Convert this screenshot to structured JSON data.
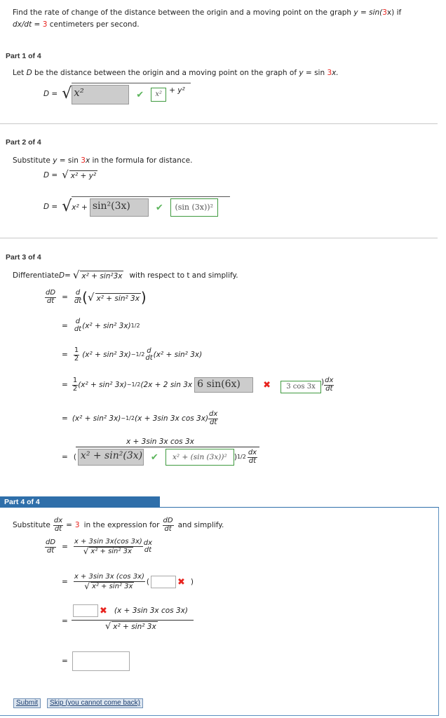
{
  "problem": {
    "line1_prefix": "Find the rate of change of the distance between the origin and a moving point on the graph ",
    "line1_eq": "y = sin(",
    "line1_coef": "3",
    "line1_tail": "x) if",
    "line2_var": "dx/dt",
    "line2_eq": " = ",
    "line2_value": "3",
    "line2_tail": " centimeters per second."
  },
  "part1": {
    "label": "Part 1 of 4",
    "intro_prefix": "Let ",
    "intro_D": "D",
    "intro_mid": " be the distance between the origin and a moving point on the graph of ",
    "intro_y": "y",
    "intro_eq": " = sin ",
    "intro_coef": "3",
    "intro_x": "x.",
    "lhs": "D =",
    "answer_entered": "x²",
    "answer_status": "correct",
    "correct_answer": "x²",
    "tail": "+ y²"
  },
  "part2": {
    "label": "Part 2 of 4",
    "intro_prefix": "Substitute ",
    "intro_y": "y",
    "intro_eq": " = sin ",
    "intro_coef": "3",
    "intro_x": "x",
    "intro_tail": " in the formula for distance.",
    "formula_lhs": "D =",
    "formula_radicand": "x² + y²",
    "lhs": "D =",
    "radicand_prefix": "x² +",
    "answer_entered": "sin²(3x)",
    "answer_status": "correct",
    "correct_answer": "(sin (3x))²"
  },
  "part3": {
    "label": "Part 3 of 4",
    "intro_prefix": "Differentiate ",
    "intro_D": "D",
    "intro_eq": " = ",
    "intro_radicand": "x² + sin²3x",
    "intro_tail": "with respect to t and simplify.",
    "step1": {
      "lhs_num": "dD",
      "lhs_den": "dt",
      "eq": "=",
      "d_num": "d",
      "d_den": "dt",
      "radicand": "x² + sin² 3x"
    },
    "step2": {
      "eq": "=",
      "d_num": "d",
      "d_den": "dt",
      "expr": "(x² + sin² 3x)",
      "exp": "1/2"
    },
    "step3": {
      "eq": "=",
      "half_num": "1",
      "half_den": "2",
      "expr": "(x² + sin² 3x)",
      "exp": "−1/2",
      "d_num": "d",
      "d_den": "dt",
      "tail": "(x² + sin² 3x)"
    },
    "step4": {
      "eq": "=",
      "half_num": "1",
      "half_den": "2",
      "expr": "(x² + sin² 3x)",
      "exp": "−1/2",
      "inner": "(2x + 2 sin 3x",
      "answer_entered": "6 sin(6x)",
      "answer_status": "incorrect",
      "correct_answer": "3 cos 3x",
      "tail_num": "dx",
      "tail_den": "dt"
    },
    "step5": {
      "eq": "=",
      "expr": "(x² + sin² 3x)",
      "exp": "−1/2",
      "inner": "(x + 3sin 3x cos 3x)",
      "tail_num": "dx",
      "tail_den": "dt"
    },
    "step6": {
      "eq": "=",
      "numerator": "x + 3sin 3x cos 3x",
      "answer_entered": "x² + sin²(3x)",
      "answer_status": "correct",
      "correct_answer": "x² + (sin (3x))²",
      "exp": "1/2",
      "tail_num": "dx",
      "tail_den": "dt"
    }
  },
  "part4": {
    "label": "Part 4 of 4",
    "intro_prefix": "Substitute",
    "intro_frac_num": "dx",
    "intro_frac_den": "dt",
    "intro_eq": "=",
    "intro_value": "3",
    "intro_mid": "in the expression for",
    "intro_frac2_num": "dD",
    "intro_frac2_den": "dt",
    "intro_tail": "and simplify.",
    "step1": {
      "lhs_num": "dD",
      "lhs_den": "dt",
      "eq": "=",
      "num": "x + 3sin 3x(cos 3x)",
      "den": "x² + sin² 3x",
      "tail_num": "dx",
      "tail_den": "dt"
    },
    "step2": {
      "eq": "=",
      "num": "x + 3sin 3x (cos 3x)",
      "den": "x² + sin² 3x",
      "input_value": "",
      "input_status": "incorrect"
    },
    "step3": {
      "eq": "=",
      "input_value": "",
      "input_status": "incorrect",
      "num_tail": "(x + 3sin 3x cos 3x)",
      "den": "x² + sin² 3x"
    },
    "step4": {
      "eq": "=",
      "input_value": ""
    }
  },
  "buttons": {
    "submit": "Submit",
    "skip": "Skip (you cannot come back)"
  },
  "icons": {
    "check": "✔",
    "cross": "✖",
    "radical": "√"
  },
  "colors": {
    "accent": "#2f6faa",
    "correct": "#5bb55b",
    "incorrect": "#e8231e",
    "highlight": "#e8231e"
  }
}
